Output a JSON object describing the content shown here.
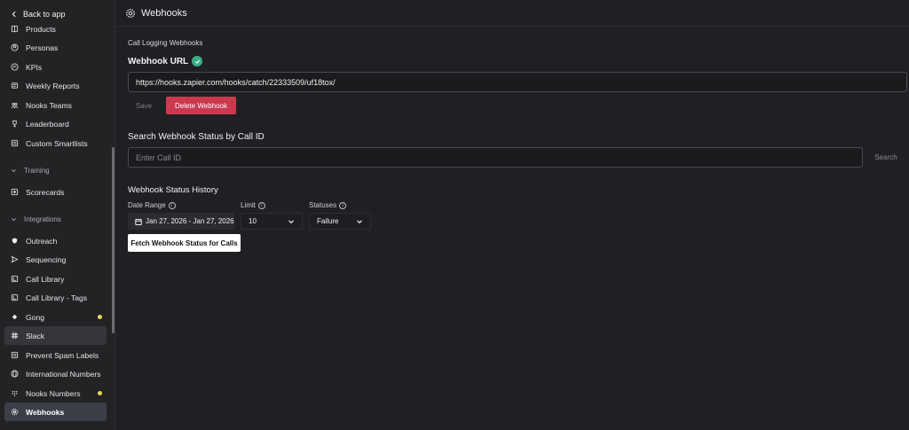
{
  "sidebar": {
    "back_label": "Back to app",
    "items_top": [
      {
        "label": "Products",
        "icon": "book-icon"
      },
      {
        "label": "Personas",
        "icon": "user-circle-icon"
      },
      {
        "label": "KPIs",
        "icon": "kpi-icon"
      },
      {
        "label": "Weekly Reports",
        "icon": "newspaper-icon"
      },
      {
        "label": "Nooks Teams",
        "icon": "users-icon"
      },
      {
        "label": "Leaderboard",
        "icon": "trophy-icon"
      },
      {
        "label": "Custom Smartlists",
        "icon": "list-icon"
      }
    ],
    "section_training": "Training",
    "items_training": [
      {
        "label": "Scorecards",
        "icon": "scorecard-icon"
      }
    ],
    "section_integrations": "Integrations",
    "items_integrations": [
      {
        "label": "Outreach",
        "icon": "outreach-icon",
        "dot": false
      },
      {
        "label": "Sequencing",
        "icon": "send-icon",
        "dot": false
      },
      {
        "label": "Call Library",
        "icon": "library-icon",
        "dot": false
      },
      {
        "label": "Call Library - Tags",
        "icon": "library-tags-icon",
        "dot": false
      },
      {
        "label": "Gong",
        "icon": "gong-icon",
        "dot": true
      },
      {
        "label": "Slack",
        "icon": "slack-icon",
        "dot": false
      },
      {
        "label": "Prevent Spam Labels",
        "icon": "tag-icon",
        "dot": false
      },
      {
        "label": "International Numbers",
        "icon": "globe-icon",
        "dot": false
      },
      {
        "label": "Nooks Numbers",
        "icon": "keypad-icon",
        "dot": true
      },
      {
        "label": "Webhooks",
        "icon": "gear-icon",
        "dot": false
      }
    ],
    "dot_color": "#e8d65a"
  },
  "header": {
    "title": "Webhooks"
  },
  "main": {
    "caption": "Call Logging Webhooks",
    "webhook_url_label": "Webhook URL",
    "webhook_url_value": "https://hooks.zapier.com/hooks/catch/22333509/uf18tox/",
    "save_label": "Save",
    "delete_label": "Delete Webhook",
    "search_heading": "Search Webhook Status by Call ID",
    "call_id_placeholder": "Enter Call ID",
    "search_label": "Search",
    "history_heading": "Webhook Status History",
    "date_range_label": "Date Range",
    "date_range_value": "Jan 27, 2026 - Jan 27, 2026",
    "limit_label": "Limit",
    "limit_value": "10",
    "statuses_label": "Statuses",
    "statuses_value": "Failure",
    "fetch_label": "Fetch Webhook Status for Calls"
  },
  "colors": {
    "accent_delete": "#c93a4f",
    "check_green": "#3cae87"
  }
}
